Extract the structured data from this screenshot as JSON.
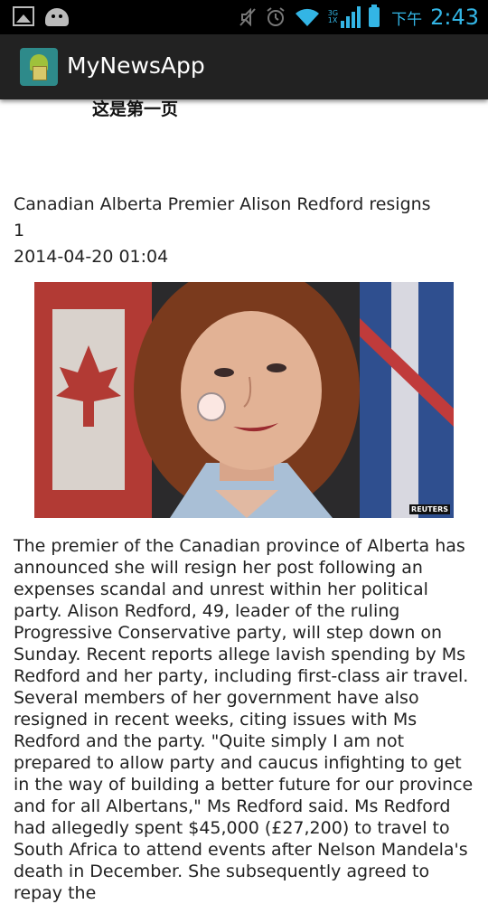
{
  "status_bar": {
    "icons": [
      "gallery-icon",
      "android-icon",
      "mute-icon",
      "alarm-icon",
      "wifi-icon",
      "signal-icon",
      "battery-icon"
    ],
    "network_labels": [
      "3G",
      "1X"
    ],
    "ampm": "下午",
    "time": "2:43",
    "accent_color": "#33b5e5"
  },
  "action_bar": {
    "title": "MyNewsApp",
    "logo_icon": "android-app-icon"
  },
  "content": {
    "page_header": "这是第一页",
    "news": {
      "title": "Canadian Alberta Premier Alison Redford resigns",
      "count": "1",
      "date": "2014-04-20 01:04",
      "image_credit": "REUTERS",
      "body": "The premier of the Canadian province of Alberta has announced she will resign her post following an expenses scandal and unrest within her political party. Alison Redford, 49, leader of the ruling Progressive Conservative party, will step down on Sunday. Recent reports allege lavish spending by Ms Redford and her party, including first-class air travel. Several members of her government have also resigned in recent weeks, citing issues with Ms Redford and the party. \"Quite simply I am not prepared to allow party and caucus infighting to get in the way of building a better future for our province and for all Albertans,\" Ms Redford said. Ms Redford had allegedly spent $45,000 (£27,200) to travel to South Africa to attend events after Nelson Mandela's death in December. She subsequently agreed to repay the"
    }
  }
}
